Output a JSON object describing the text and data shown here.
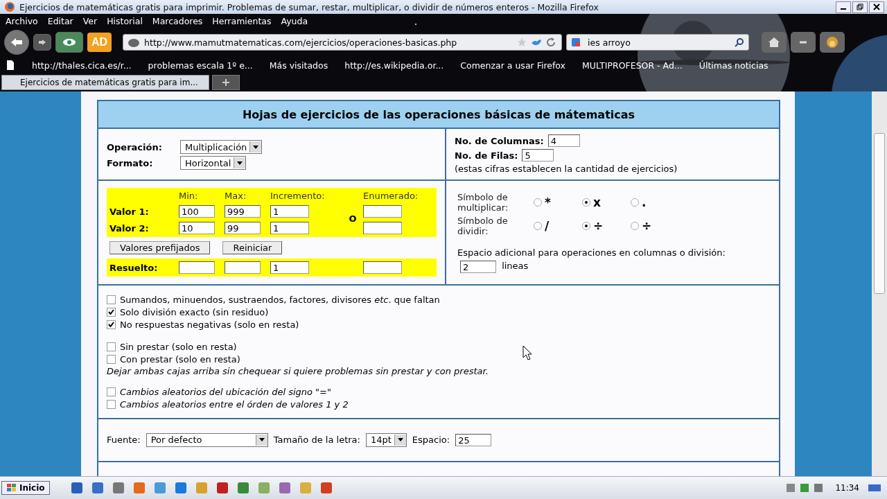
{
  "window": {
    "title": "Ejercicios de matemáticas gratis para imprimir. Problemas de sumar, restar, multiplicar, o dividir de números enteros - Mozilla Firefox"
  },
  "menu": [
    "Archivo",
    "Editar",
    "Ver",
    "Historial",
    "Marcadores",
    "Herramientas",
    "Ayuda"
  ],
  "toolbar": {
    "addon_label": "AD",
    "url": "http://www.mamutmatematicas.com/ejercicios/operaciones-basicas.php",
    "search_value": "ies arroyo"
  },
  "bookmarks": [
    "http://thales.cica.es/r...",
    "problemas escala 1º e...",
    "Más visitados",
    "http://es.wikipedia.or...",
    "Comenzar a usar Firefox",
    "MULTIPROFESOR - Ad...",
    "Últimas noticias"
  ],
  "tabs": [
    {
      "label": "Ejercicios de matemáticas gratis para im...",
      "selected": true
    }
  ],
  "form": {
    "heading": "Hojas de ejercicios de las operaciones básicas de mátematicas",
    "operation": {
      "label": "Operación:",
      "value": "Multiplicación"
    },
    "format": {
      "label": "Formato:",
      "value": "Horizontal"
    },
    "columns": {
      "label": "No. de Columnas:",
      "value": "4"
    },
    "rows": {
      "label": "No. de Filas:",
      "value": "5"
    },
    "grid_note": "(estas cifras establecen la cantidad de ejercicios)",
    "range_headers": [
      "Min:",
      "Max:",
      "Incremento:",
      "Enumerado:"
    ],
    "ranges": [
      {
        "label": "Valor 1:",
        "min": "100",
        "max": "999",
        "increment": "1"
      },
      {
        "label": "Valor 2:",
        "min": "10",
        "max": "99",
        "increment": "1"
      }
    ],
    "or_label": "O",
    "buttons": [
      "Valores prefijados",
      "Reiniciar"
    ],
    "solved": {
      "label": "Resuelto:",
      "increment": "1"
    },
    "symbols": [
      {
        "label": "Símbolo de multiplicar:",
        "options": [
          {
            "symbol": "*",
            "selected": false
          },
          {
            "symbol": "x",
            "selected": true
          },
          {
            "symbol": ".",
            "selected": false
          }
        ]
      },
      {
        "label": "Símbolo de dividir:",
        "options": [
          {
            "symbol": "/",
            "selected": false
          },
          {
            "symbol": "÷",
            "selected": true
          },
          {
            "symbol": "÷",
            "selected": false
          }
        ]
      }
    ],
    "extra_space": {
      "label": "Espacio adicional para operaciones en columnas o división:",
      "value": "2",
      "unit": "lineas"
    },
    "option_groups": [
      {
        "italic": false,
        "options": [
          {
            "label": "Sumandos, minuendos, sustraendos, factores, divisores *etc*. que faltan",
            "checked": false
          },
          {
            "label": "Solo división exacto (sin residuo)",
            "checked": true
          },
          {
            "label": "No respuestas negativas (solo en resta)",
            "checked": true
          }
        ]
      },
      {
        "italic": false,
        "options": [
          {
            "label": "Sin prestar (solo en resta)",
            "checked": false
          },
          {
            "label": "Con prestar (solo en resta)",
            "checked": false
          }
        ],
        "note": "Dejar ambas cajas arriba sin chequear si quiere problemas sin prestar y con prestar."
      },
      {
        "italic": true,
        "options": [
          {
            "label": "Cambios aleatorios del ubicación del signo \"=\"",
            "checked": false
          },
          {
            "label": "Cambios aleatorios entre el órden de valores 1 y 2",
            "checked": false
          }
        ]
      }
    ],
    "font": {
      "label": "Fuente:",
      "value": "Por defecto"
    },
    "size": {
      "label": "Tamaño de la letra:",
      "value": "14pt"
    },
    "spacing": {
      "label": "Espacio:",
      "value": "25"
    }
  },
  "taskbar": {
    "start": "Inicio",
    "clock": "11:34"
  }
}
